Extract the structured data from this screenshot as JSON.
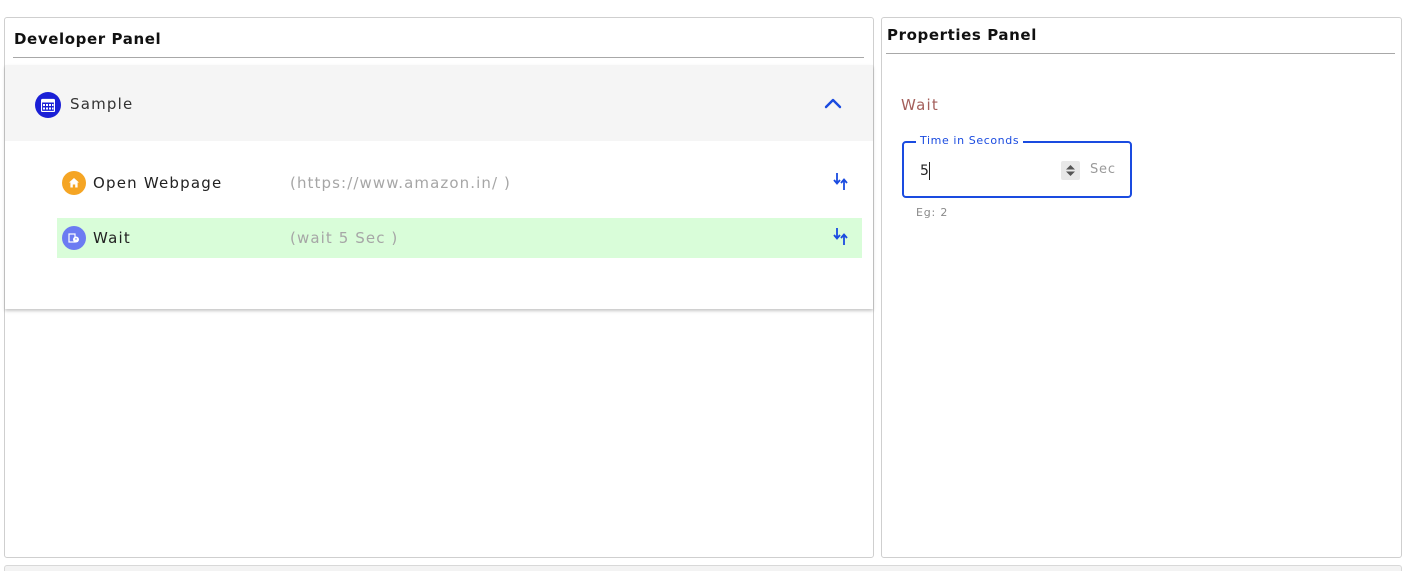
{
  "developer_panel": {
    "title": "Developer Panel",
    "flow": {
      "name": "Sample",
      "expanded": true,
      "steps": [
        {
          "label": "Open Webpage",
          "detail": "(https://www.amazon.in/ )",
          "selected": false,
          "icon": "home-icon"
        },
        {
          "label": "Wait",
          "detail": "(wait 5 Sec )",
          "selected": true,
          "icon": "timer-icon"
        }
      ]
    }
  },
  "properties_panel": {
    "title": "Properties Panel",
    "heading": "Wait",
    "time_field": {
      "label": "Time in Seconds",
      "value": "5",
      "unit": "Sec",
      "hint": "Eg: 2"
    }
  },
  "colors": {
    "accent": "#1a4be0",
    "selected_row": "#d9fdd9",
    "heading": "#a4605c",
    "open_webpage_icon": "#f5a524",
    "wait_icon": "#6c7bf2",
    "flow_icon": "#1a1fd6"
  }
}
